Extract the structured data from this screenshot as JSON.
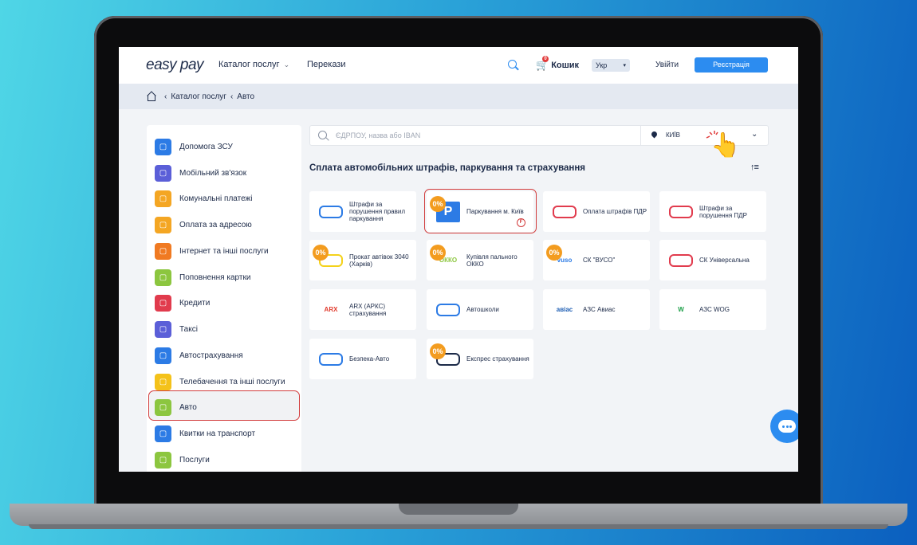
{
  "header": {
    "logo": "easy pay",
    "catalog_label": "Каталог послуг",
    "transfers_label": "Перекази",
    "cart_label": "Кошик",
    "cart_count": "0",
    "language": "Укр",
    "login_label": "Увійти",
    "register_label": "Реєстрація"
  },
  "breadcrumb": {
    "items": [
      "Каталог послуг",
      "Авто"
    ]
  },
  "sidebar": {
    "items": [
      {
        "label": "Допомога ЗСУ",
        "color": "#2c7be5",
        "icon": "army-help-icon"
      },
      {
        "label": "Мобільний зв'язок",
        "color": "#5b5fd8",
        "icon": "phone-icon"
      },
      {
        "label": "Комунальні платежі",
        "color": "#f4a623",
        "icon": "bulb-icon"
      },
      {
        "label": "Оплата за адресою",
        "color": "#f4a623",
        "icon": "house-icon"
      },
      {
        "label": "Інтернет та інші послуги",
        "color": "#f07a22",
        "icon": "globe-icon"
      },
      {
        "label": "Поповнення картки",
        "color": "#8cc63f",
        "icon": "card-icon"
      },
      {
        "label": "Кредити",
        "color": "#e13b4d",
        "icon": "bank-icon"
      },
      {
        "label": "Таксі",
        "color": "#5b5fd8",
        "icon": "taxi-icon"
      },
      {
        "label": "Автострахування",
        "color": "#2c7be5",
        "icon": "insurance-icon"
      },
      {
        "label": "Телебачення та інші послуги",
        "color": "#f4c21a",
        "icon": "tv-icon"
      },
      {
        "label": "Авто",
        "color": "#8cc63f",
        "icon": "car-icon"
      },
      {
        "label": "Квитки на транспорт",
        "color": "#2c7be5",
        "icon": "bus-icon"
      },
      {
        "label": "Послуги",
        "color": "#8cc63f",
        "icon": "services-icon"
      }
    ]
  },
  "search": {
    "placeholder": "ЄДРПОУ, назва або IBAN",
    "city": "КИЇВ"
  },
  "section_title": "Сплата автомобільних штрафів, паркування та страхування",
  "cards": [
    {
      "label": "Штрафи за порушення правил паркування",
      "logo_text": "",
      "logo_color": "#2c7be5",
      "zero": false
    },
    {
      "label": "Паркування м. Київ",
      "logo_text": "P",
      "logo_color": "#2c7be5",
      "zero": true
    },
    {
      "label": "Оплата штрафів ПДР",
      "logo_text": "",
      "logo_color": "#e13b4d",
      "zero": false
    },
    {
      "label": "Штрафи за порушення ПДР",
      "logo_text": "",
      "logo_color": "#e13b4d",
      "zero": false
    },
    {
      "label": "Прокат автівок 3040 (Харків)",
      "logo_text": "",
      "logo_color": "#f4d21a",
      "zero": true
    },
    {
      "label": "Купівля пального ОККО",
      "logo_text": "ОККО",
      "logo_color": "#8cc63f",
      "zero": true
    },
    {
      "label": "СК \"ВУСО\"",
      "logo_text": "vuso",
      "logo_color": "#2c7be5",
      "zero": true
    },
    {
      "label": "СК Універсальна",
      "logo_text": "",
      "logo_color": "#e13b4d",
      "zero": false
    },
    {
      "label": "ARX (АРКС) страхування",
      "logo_text": "ARX",
      "logo_color": "#e13b2d",
      "zero": false
    },
    {
      "label": "Автошколи",
      "logo_text": "",
      "logo_color": "#2c7be5",
      "zero": false
    },
    {
      "label": "АЗС Авиас",
      "logo_text": "авіас",
      "logo_color": "#1f5fb4",
      "zero": false
    },
    {
      "label": "АЗС WOG",
      "logo_text": "W",
      "logo_color": "#1ea04a",
      "zero": false
    },
    {
      "label": "Безпека-Авто",
      "logo_text": "",
      "logo_color": "#2c7be5",
      "zero": false
    },
    {
      "label": "Експрес страхування",
      "logo_text": "",
      "logo_color": "#1c2a48",
      "zero": true
    }
  ],
  "colors": {
    "accent": "#2c8cf0",
    "highlight": "#d23c3c",
    "zero_badge": "#f39c1f"
  }
}
